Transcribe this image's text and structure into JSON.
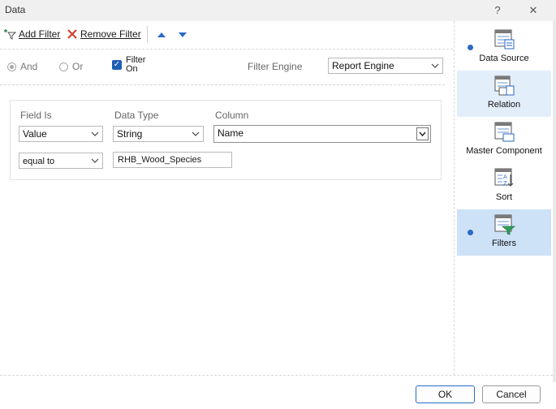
{
  "window": {
    "title": "Data",
    "help_label": "?",
    "close_label": "✕"
  },
  "toolbar": {
    "add_filter": "Add Filter",
    "remove_filter": "Remove Filter"
  },
  "logic": {
    "and_label": "And",
    "or_label": "Or",
    "filter_on_label_1": "Filter",
    "filter_on_label_2": "On",
    "filter_engine_label": "Filter Engine",
    "filter_engine_value": "Report Engine"
  },
  "filter": {
    "field_is_label": "Field Is",
    "data_type_label": "Data Type",
    "column_label": "Column",
    "field_is_value": "Value",
    "data_type_value": "String",
    "column_value": "Name",
    "condition_value": "equal to",
    "text_value": "RHB_Wood_Species"
  },
  "sidebar": {
    "items": [
      {
        "label": "Data Source",
        "icon": "data-source-icon"
      },
      {
        "label": "Relation",
        "icon": "relation-icon"
      },
      {
        "label": "Master Component",
        "icon": "master-component-icon"
      },
      {
        "label": "Sort",
        "icon": "sort-icon"
      },
      {
        "label": "Filters",
        "icon": "filters-icon"
      }
    ]
  },
  "footer": {
    "ok_label": "OK",
    "cancel_label": "Cancel"
  },
  "colors": {
    "accent": "#2a6ac6",
    "selected": "#cde1f7"
  }
}
